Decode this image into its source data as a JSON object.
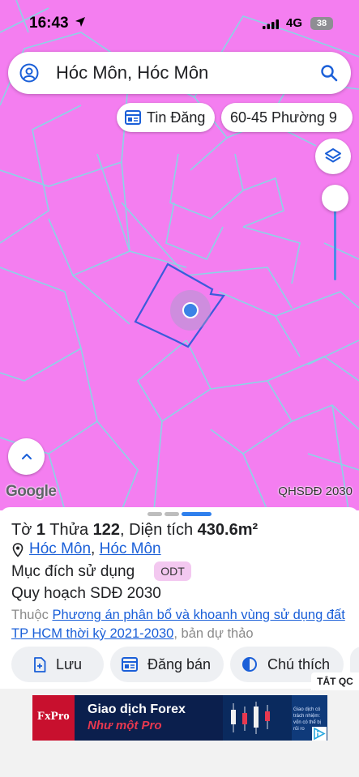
{
  "status_bar": {
    "time": "16:43",
    "network": "4G",
    "battery": "38"
  },
  "search": {
    "query": "Hóc Môn, Hóc Môn"
  },
  "chips": {
    "news": "Tin Đăng",
    "ward": "60-45 Phường 9"
  },
  "map": {
    "attribution": "Google",
    "layer_label": "QHSDĐ 2030",
    "colors": {
      "land": "#f47ef0",
      "boundary": "#8ad4e6",
      "selected": "#3b5bdb",
      "location": "#3b82e6"
    }
  },
  "parcel": {
    "sheet_label": "Tờ",
    "sheet_no": "1",
    "plot_label": "Thửa",
    "plot_no": "122",
    "area_label": ", Diện tích",
    "area_value": "430.6m²",
    "district": "Hóc Môn",
    "separator": ",",
    "province": "Hóc Môn",
    "purpose_label": "Mục đích sử dụng",
    "purpose_code": "ODT",
    "plan_label": "Quy hoạch SDĐ 2030",
    "desc_prefix": "Thuộc",
    "desc_link": "Phương án phân bổ và khoanh vùng sử dụng đất TP HCM thời kỳ 2021-2030",
    "desc_suffix": ", bản dự thảo"
  },
  "actions": {
    "save": "Lưu",
    "post": "Đăng bán",
    "note": "Chú thích"
  },
  "ad": {
    "close_label": "TẮT QC",
    "brand": "FxPro",
    "title": "Giao dịch Forex",
    "subtitle": "Như một Pro",
    "disclaimer": "Giao dịch có trách nhiệm: vốn có thể bị rủi ro"
  }
}
